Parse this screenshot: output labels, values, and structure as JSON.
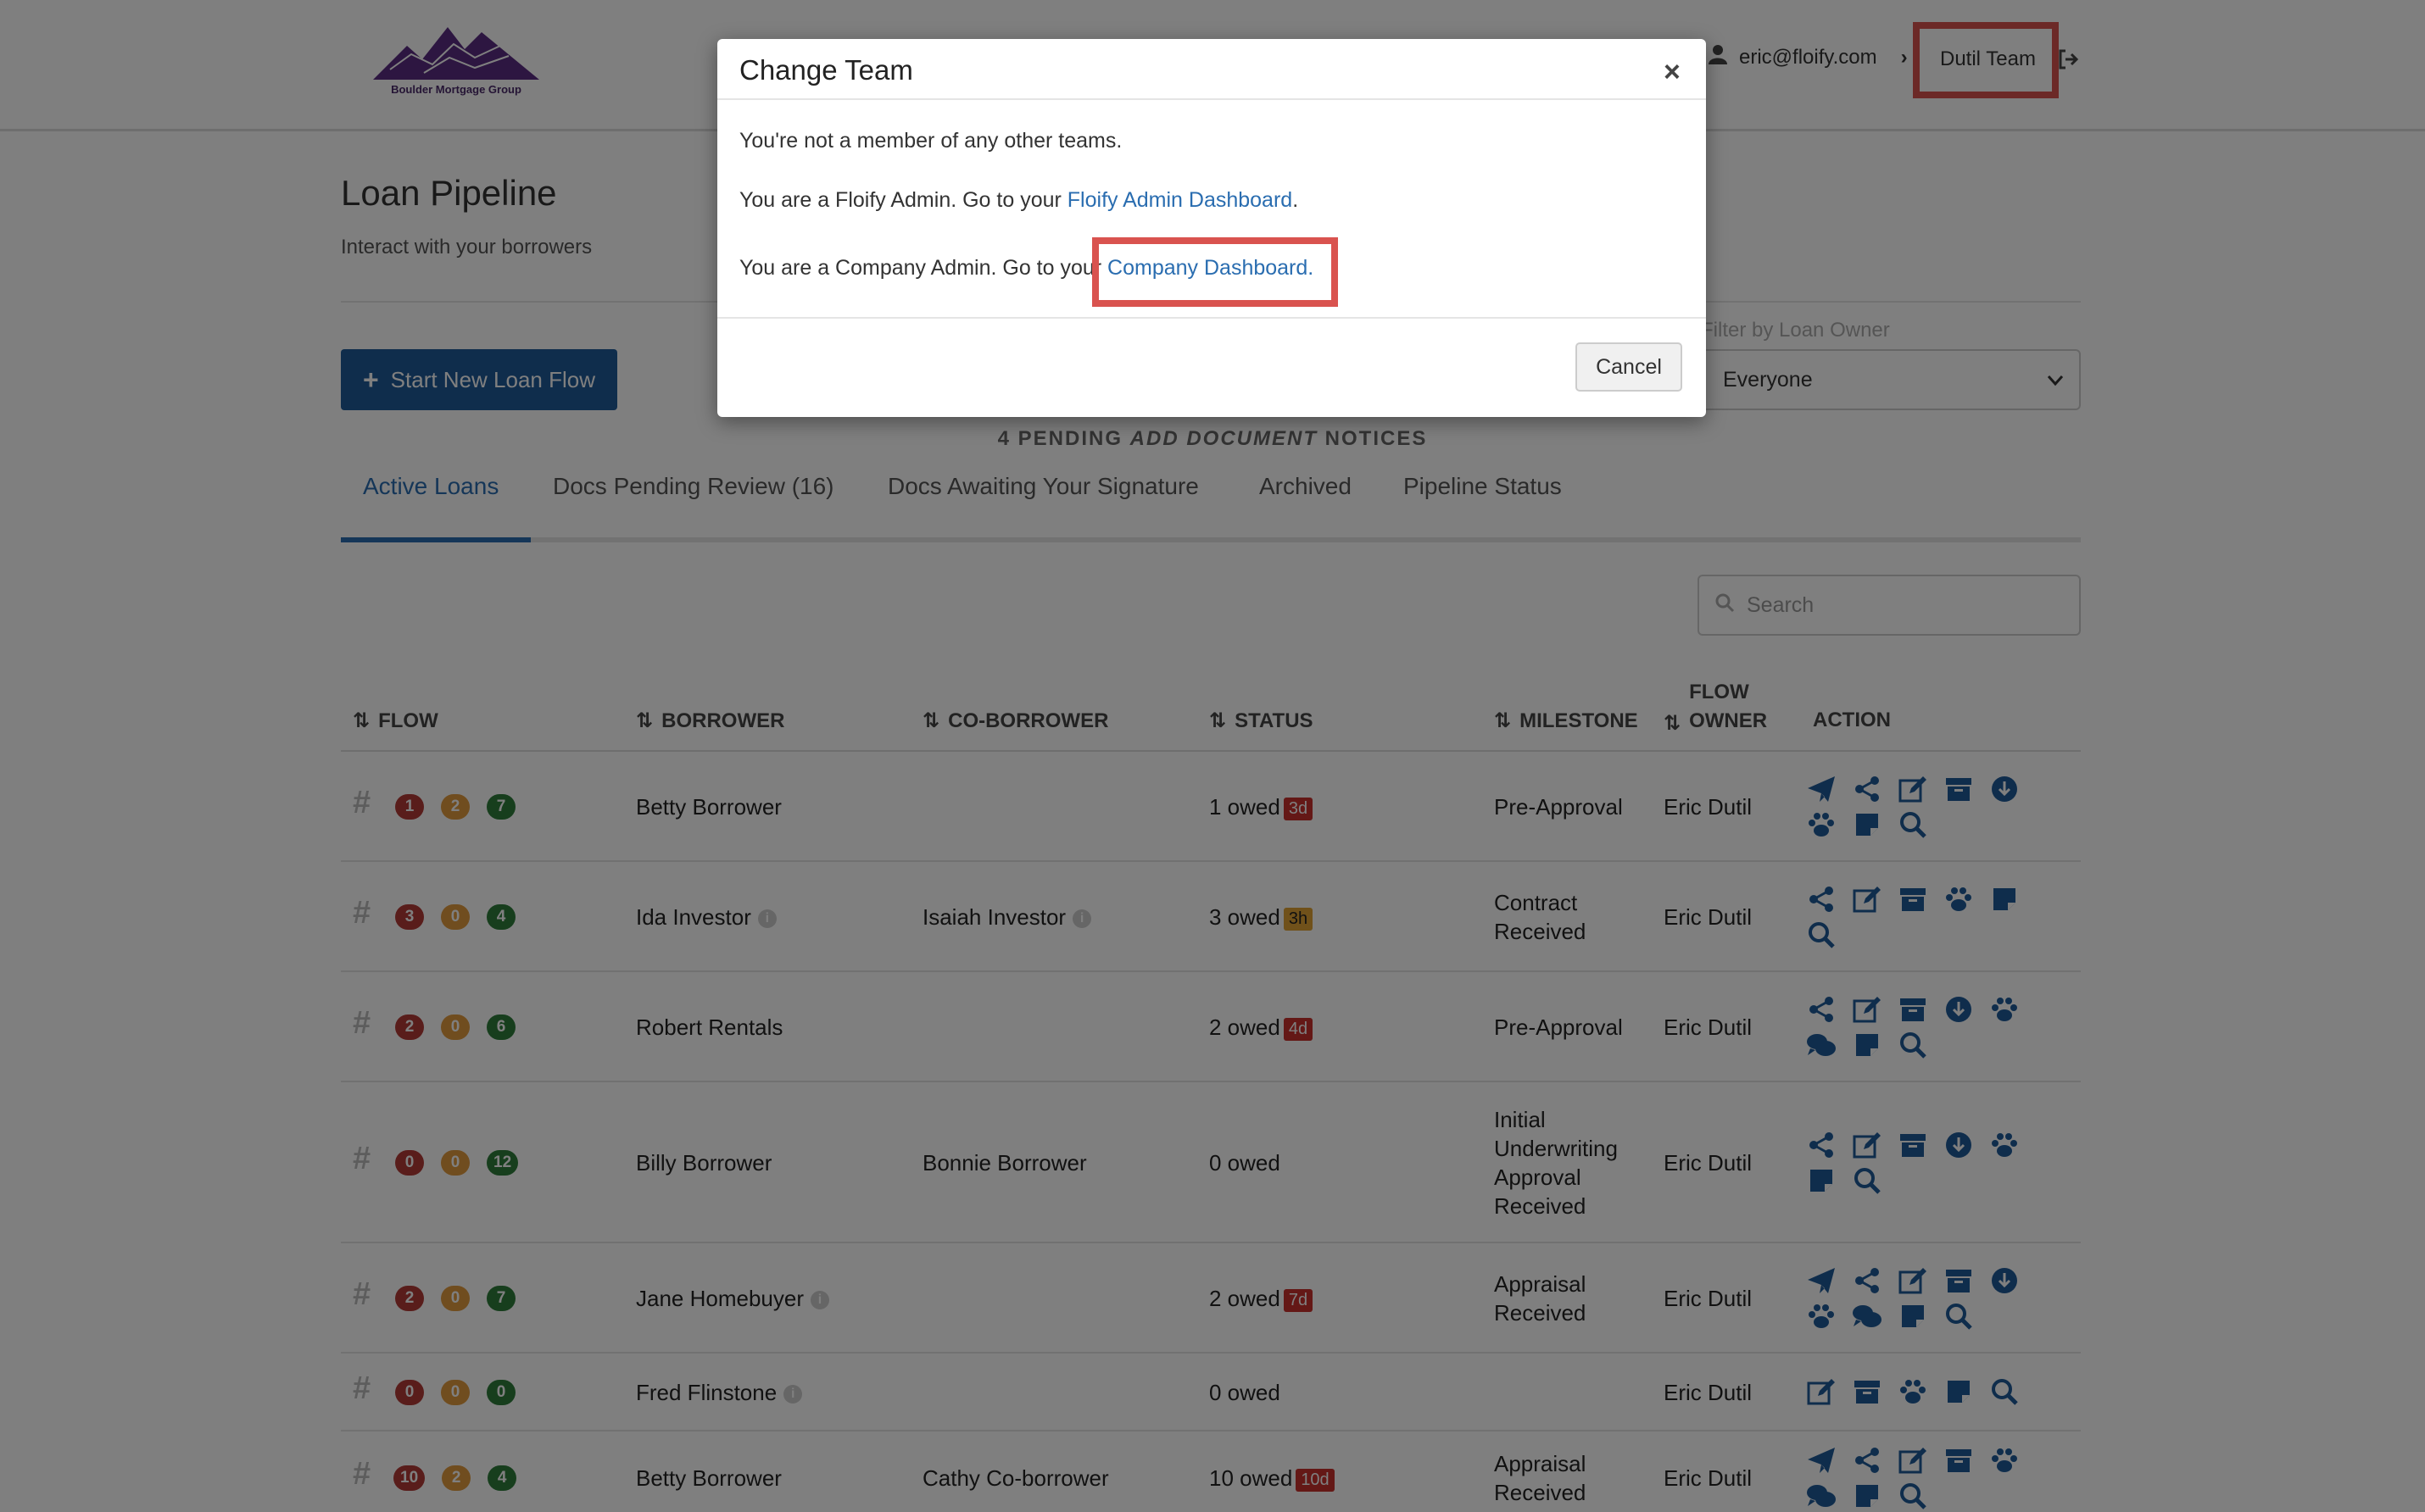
{
  "colors": {
    "primary": "#1f5b99",
    "link": "#2a6db0",
    "danger": "#b33a36",
    "warning": "#e09a3e",
    "success": "#2e7d3b",
    "highlight": "#d9534f"
  },
  "header": {
    "logo_text": "Boulder Mortgage Group",
    "user_email": "eric@floify.com",
    "team_label": "Dutil Team"
  },
  "page": {
    "title": "Loan Pipeline",
    "subtitle": "Interact with your borrowers",
    "new_button": "Start New Loan Flow",
    "filter_label": "Filter by Loan Owner",
    "filter_value": "Everyone",
    "notice_prefix": "4 PENDING ",
    "notice_emph": "ADD DOCUMENT",
    "notice_suffix": " NOTICES"
  },
  "tabs": [
    "Active Loans",
    "Docs Pending Review (16)",
    "Docs Awaiting Your Signature",
    "Archived",
    "Pipeline Status"
  ],
  "search": {
    "placeholder": "Search"
  },
  "columns": {
    "flow": "FLOW",
    "borrower": "BORROWER",
    "coborrower": "CO-BORROWER",
    "status": "STATUS",
    "milestone": "MILESTONE",
    "owner_top": "FLOW",
    "owner_bottom": "OWNER",
    "action": "ACTION"
  },
  "rows": [
    {
      "b": [
        "1",
        "2",
        "7"
      ],
      "borrower": "Betty Borrower",
      "borrower_info": false,
      "coborrower": "",
      "coborrower_info": false,
      "owed": "1 owed",
      "tag": "3d",
      "tag_color": "red",
      "milestone": [
        "Pre-Approval"
      ],
      "owner": "Eric Dutil",
      "actions": [
        "send-icon",
        "share-icon",
        "edit-icon",
        "archive-icon",
        "download-icon",
        "paw-icon",
        "note-icon",
        "search-icon"
      ]
    },
    {
      "b": [
        "3",
        "0",
        "4"
      ],
      "borrower": "Ida Investor",
      "borrower_info": true,
      "coborrower": "Isaiah Investor",
      "coborrower_info": true,
      "owed": "3 owed",
      "tag": "3h",
      "tag_color": "orange",
      "milestone": [
        "Contract",
        "Received"
      ],
      "owner": "Eric Dutil",
      "actions": [
        "share-icon",
        "edit-icon",
        "archive-icon",
        "paw-icon",
        "note-icon",
        "search-icon"
      ]
    },
    {
      "b": [
        "2",
        "0",
        "6"
      ],
      "borrower": "Robert Rentals",
      "borrower_info": false,
      "coborrower": "",
      "coborrower_info": false,
      "owed": "2 owed",
      "tag": "4d",
      "tag_color": "red",
      "milestone": [
        "Pre-Approval"
      ],
      "owner": "Eric Dutil",
      "actions": [
        "share-icon",
        "edit-icon",
        "archive-icon",
        "download-icon",
        "paw-icon",
        "comments-icon",
        "note-icon",
        "search-icon"
      ]
    },
    {
      "b": [
        "0",
        "0",
        "12"
      ],
      "borrower": "Billy Borrower",
      "borrower_info": false,
      "coborrower": "Bonnie Borrower",
      "coborrower_info": false,
      "owed": "0 owed",
      "tag": "",
      "tag_color": "",
      "milestone": [
        "Initial",
        "Underwriting",
        "Approval",
        "Received"
      ],
      "owner": "Eric Dutil",
      "actions": [
        "share-icon",
        "edit-icon",
        "archive-icon",
        "download-icon",
        "paw-icon",
        "note-icon",
        "search-icon"
      ]
    },
    {
      "b": [
        "2",
        "0",
        "7"
      ],
      "borrower": "Jane Homebuyer",
      "borrower_info": true,
      "coborrower": "",
      "coborrower_info": false,
      "owed": "2 owed",
      "tag": "7d",
      "tag_color": "red",
      "milestone": [
        "Appraisal",
        "Received"
      ],
      "owner": "Eric Dutil",
      "actions": [
        "send-icon",
        "share-icon",
        "edit-icon",
        "archive-icon",
        "download-icon",
        "paw-icon",
        "comments-icon",
        "note-icon",
        "search-icon"
      ]
    },
    {
      "b": [
        "0",
        "0",
        "0"
      ],
      "borrower": "Fred Flinstone",
      "borrower_info": true,
      "coborrower": "",
      "coborrower_info": false,
      "owed": "0 owed",
      "tag": "",
      "tag_color": "",
      "milestone": [],
      "owner": "Eric Dutil",
      "actions": [
        "edit-icon",
        "archive-icon",
        "paw-icon",
        "note-icon",
        "search-icon"
      ]
    },
    {
      "b": [
        "10",
        "2",
        "4"
      ],
      "borrower": "Betty Borrower",
      "borrower_info": false,
      "coborrower": "Cathy Co-borrower",
      "coborrower_info": false,
      "owed": "10 owed",
      "tag": "10d",
      "tag_color": "red",
      "milestone": [
        "Appraisal",
        "Received"
      ],
      "owner": "Eric Dutil",
      "actions": [
        "send-icon",
        "share-icon",
        "edit-icon",
        "archive-icon",
        "paw-icon",
        "comments-icon",
        "note-icon",
        "search-icon"
      ]
    }
  ],
  "modal": {
    "title": "Change Team",
    "close": "×",
    "line1": "You're not a member of any other teams.",
    "line2_prefix": "You are a Floify Admin. Go to your ",
    "line2_link": "Floify Admin Dashboard",
    "line2_suffix": ".",
    "line3_prefix": "You are a Company Admin. Go to your ",
    "line3_link": "Company Dashboard.",
    "cancel": "Cancel"
  }
}
